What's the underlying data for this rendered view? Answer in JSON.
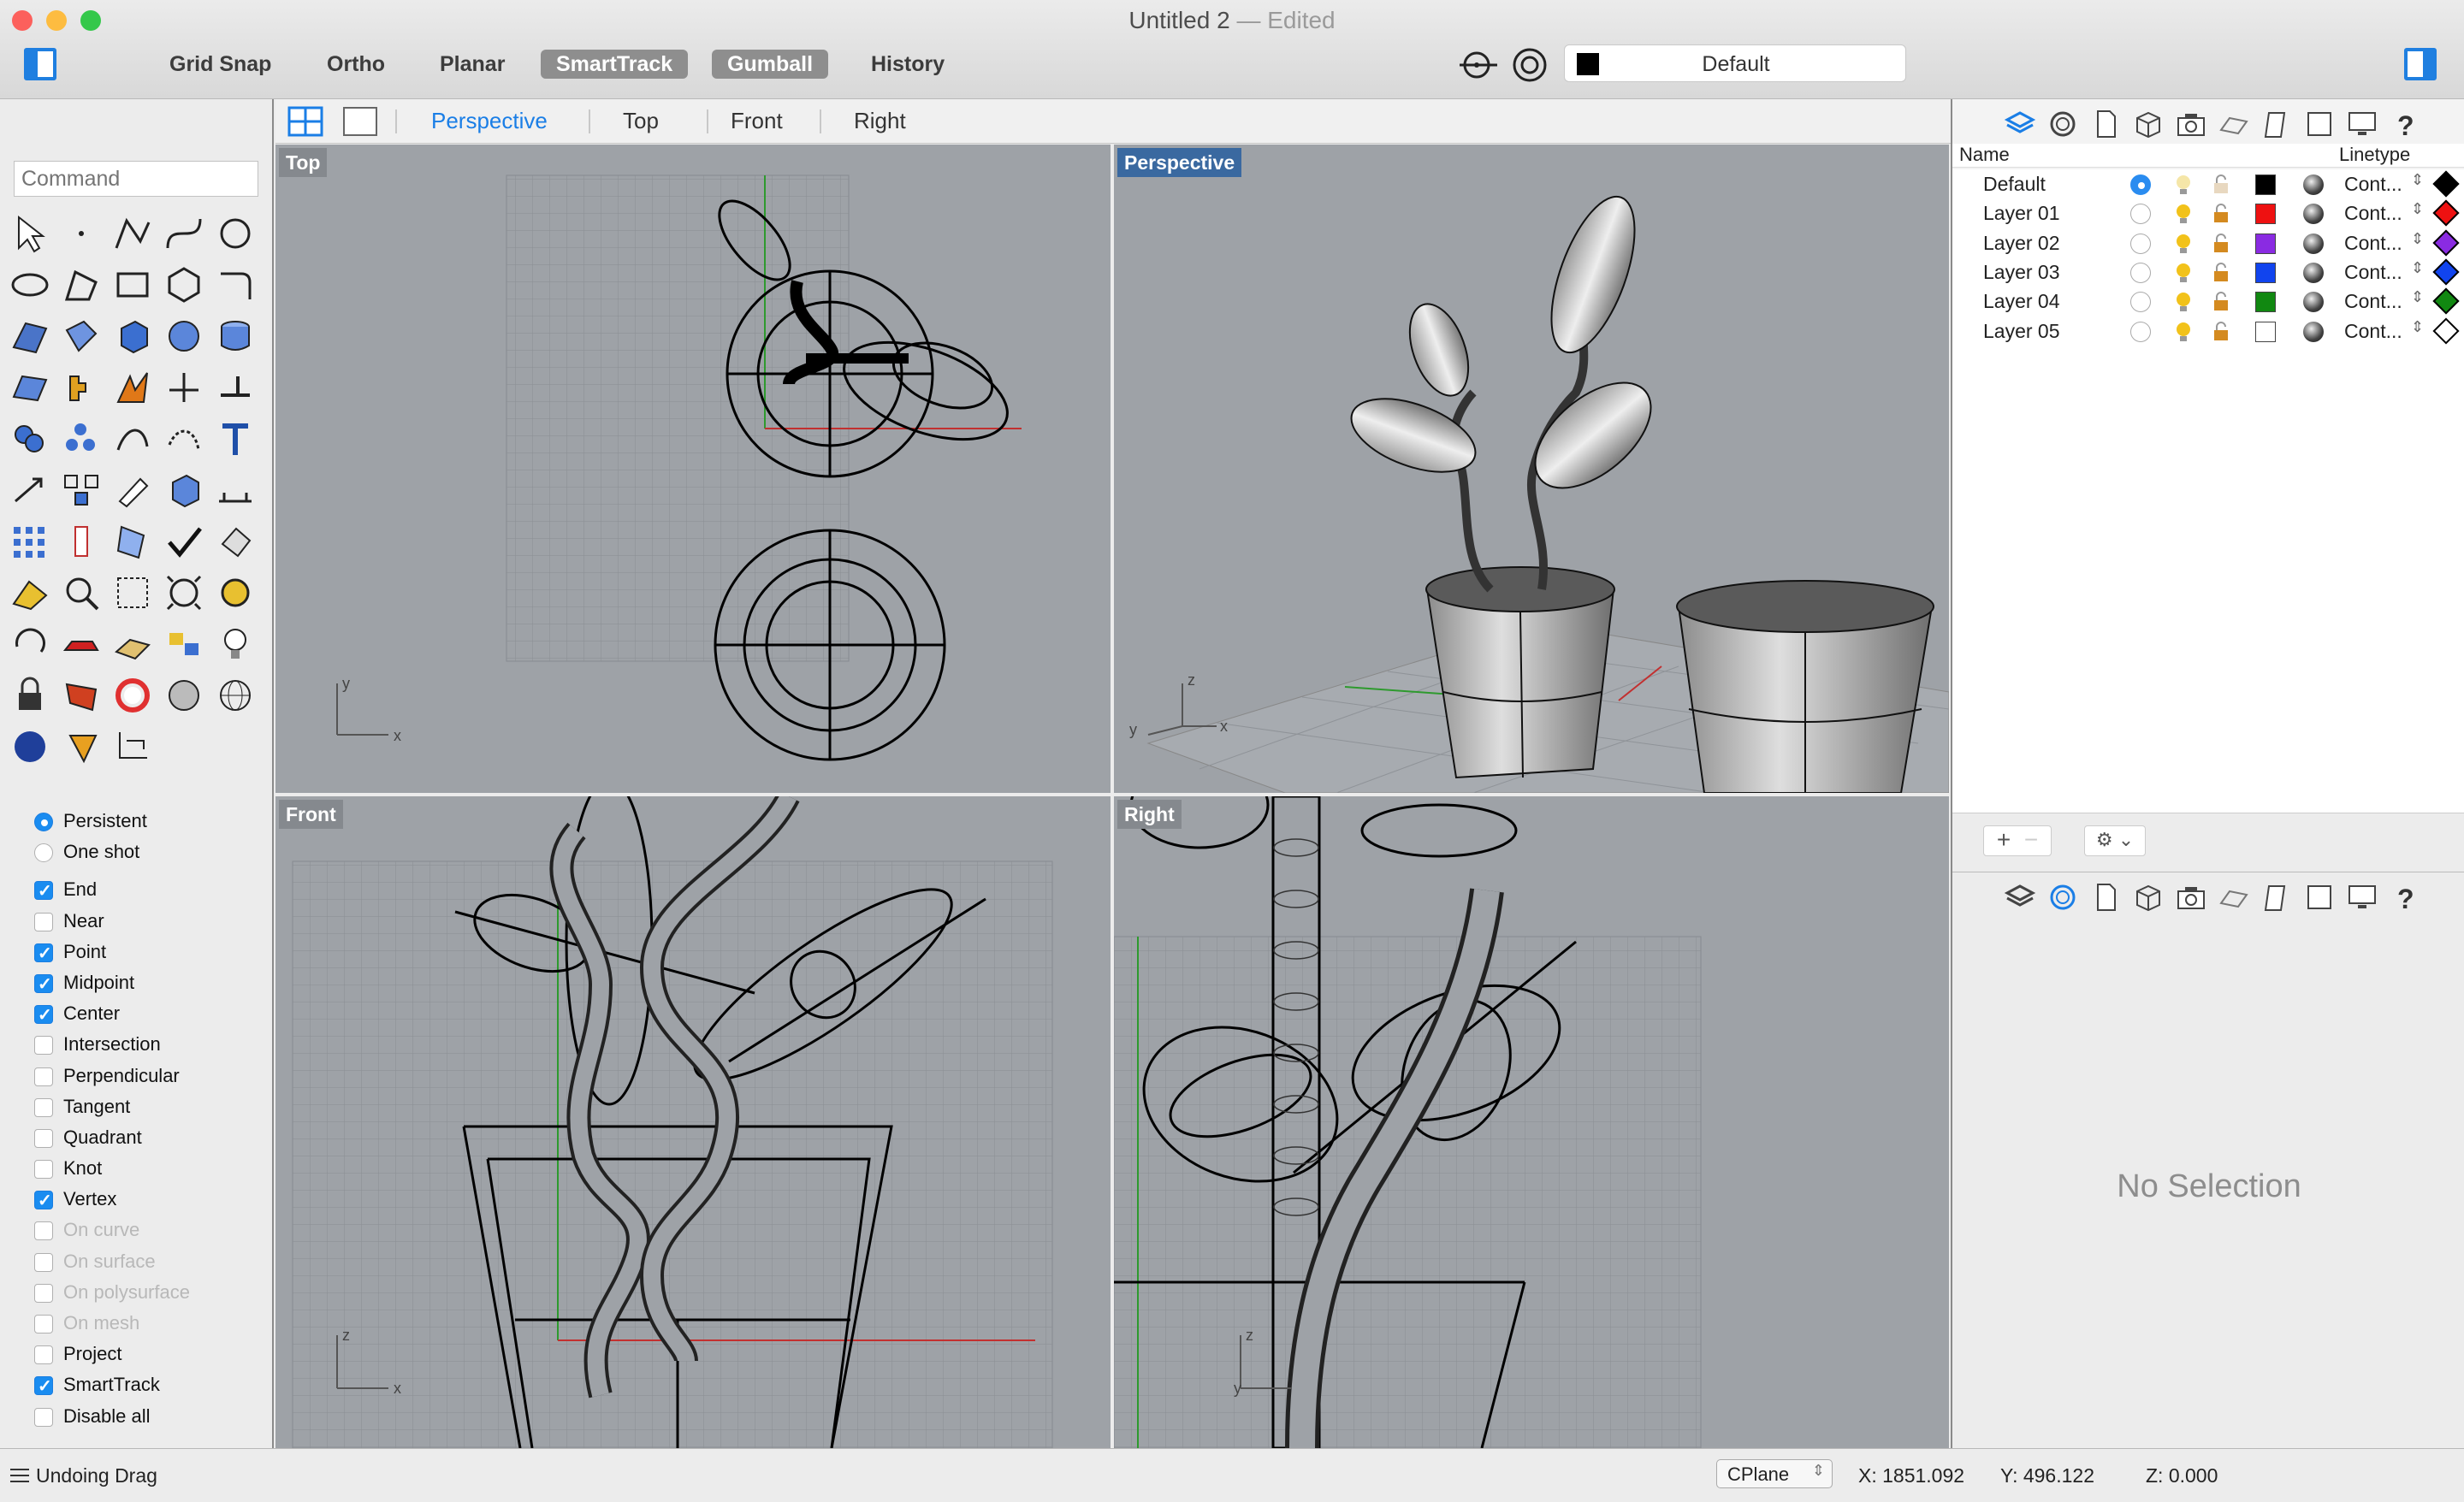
{
  "window": {
    "title": "Untitled 2",
    "title_suffix": "— Edited"
  },
  "toolbar": {
    "buttons": [
      {
        "label": "Grid Snap",
        "on": false
      },
      {
        "label": "Ortho",
        "on": false
      },
      {
        "label": "Planar",
        "on": false
      },
      {
        "label": "SmartTrack",
        "on": true
      },
      {
        "label": "Gumball",
        "on": true
      },
      {
        "label": "History",
        "on": false
      }
    ],
    "layer": {
      "name": "Default",
      "color": "#000000"
    }
  },
  "command": {
    "placeholder": "Command"
  },
  "viewport_tabs": [
    "Perspective",
    "Top",
    "Front",
    "Right"
  ],
  "active_tab": "Perspective",
  "viewports": {
    "top": {
      "label": "Top",
      "axis_x": "x",
      "axis_y": "y"
    },
    "perspective": {
      "label": "Perspective",
      "axis_x": "x",
      "axis_y": "y",
      "axis_z": "z"
    },
    "front": {
      "label": "Front",
      "axis_x": "x",
      "axis_z": "z"
    },
    "right": {
      "label": "Right",
      "axis_y": "y",
      "axis_z": "z"
    }
  },
  "tools": [
    "select-arrow",
    "point",
    "polyline",
    "curve-control-points",
    "circle",
    "ellipse",
    "arc-polygon",
    "rectangle",
    "polygon",
    "fillet-curves",
    "surface-from-points",
    "extrude-surface",
    "box",
    "sphere",
    "cylinder",
    "mesh-plane",
    "puzzle-mesh",
    "mesh-reduce",
    "split",
    "trim",
    "boolean-union",
    "group",
    "curve-from-object",
    "offset-curve",
    "text",
    "move",
    "array",
    "edit-points",
    "box-edit",
    "dimension",
    "grid-array",
    "align",
    "clipping",
    "check",
    "render-preview",
    "cplane",
    "zoom",
    "zoom-window",
    "zoom-extents",
    "zoom-target",
    "rotate-view",
    "car-model",
    "analyze-grid",
    "snapshot",
    "light",
    "lock",
    "layer-material",
    "color-wheel",
    "shade-sphere",
    "wire-sphere",
    "render-sphere",
    "cone-tool",
    "crop"
  ],
  "osnap": {
    "modes": [
      {
        "label": "Persistent",
        "checked": true
      },
      {
        "label": "One shot",
        "checked": false
      }
    ],
    "items": [
      {
        "label": "End",
        "checked": true,
        "enabled": true
      },
      {
        "label": "Near",
        "checked": false,
        "enabled": true
      },
      {
        "label": "Point",
        "checked": true,
        "enabled": true
      },
      {
        "label": "Midpoint",
        "checked": true,
        "enabled": true
      },
      {
        "label": "Center",
        "checked": true,
        "enabled": true
      },
      {
        "label": "Intersection",
        "checked": false,
        "enabled": true
      },
      {
        "label": "Perpendicular",
        "checked": false,
        "enabled": true
      },
      {
        "label": "Tangent",
        "checked": false,
        "enabled": true
      },
      {
        "label": "Quadrant",
        "checked": false,
        "enabled": true
      },
      {
        "label": "Knot",
        "checked": false,
        "enabled": true
      },
      {
        "label": "Vertex",
        "checked": true,
        "enabled": true
      },
      {
        "label": "On curve",
        "checked": false,
        "enabled": false
      },
      {
        "label": "On surface",
        "checked": false,
        "enabled": false
      },
      {
        "label": "On polysurface",
        "checked": false,
        "enabled": false
      },
      {
        "label": "On mesh",
        "checked": false,
        "enabled": false
      },
      {
        "label": "Project",
        "checked": false,
        "enabled": true
      },
      {
        "label": "SmartTrack",
        "checked": true,
        "enabled": true
      },
      {
        "label": "Disable all",
        "checked": false,
        "enabled": true
      }
    ]
  },
  "layers": {
    "header": {
      "name": "Name",
      "linetype": "Linetype"
    },
    "rows": [
      {
        "name": "Default",
        "current": true,
        "color": "#000000",
        "linetype": "Cont...",
        "print_color": "#000000"
      },
      {
        "name": "Layer 01",
        "current": false,
        "color": "#ee1111",
        "linetype": "Cont...",
        "print_color": "#ee1111"
      },
      {
        "name": "Layer 02",
        "current": false,
        "color": "#8a2be2",
        "linetype": "Cont...",
        "print_color": "#8a2be2"
      },
      {
        "name": "Layer 03",
        "current": false,
        "color": "#1144ee",
        "linetype": "Cont...",
        "print_color": "#1144ee"
      },
      {
        "name": "Layer 04",
        "current": false,
        "color": "#118811",
        "linetype": "Cont...",
        "print_color": "#118811"
      },
      {
        "name": "Layer 05",
        "current": false,
        "color": "#ffffff",
        "linetype": "Cont...",
        "print_color": "#ffffff"
      }
    ]
  },
  "properties": {
    "empty_text": "No Selection"
  },
  "status": {
    "message": "Undoing Drag",
    "cplane": "CPlane",
    "x": "X: 1851.092",
    "y": "Y: 496.122",
    "z": "Z: 0.000"
  },
  "colors": {
    "accent": "#1a7ee6",
    "viewport_bg": "#9ea2a7",
    "active_label": "#3a69a0"
  }
}
